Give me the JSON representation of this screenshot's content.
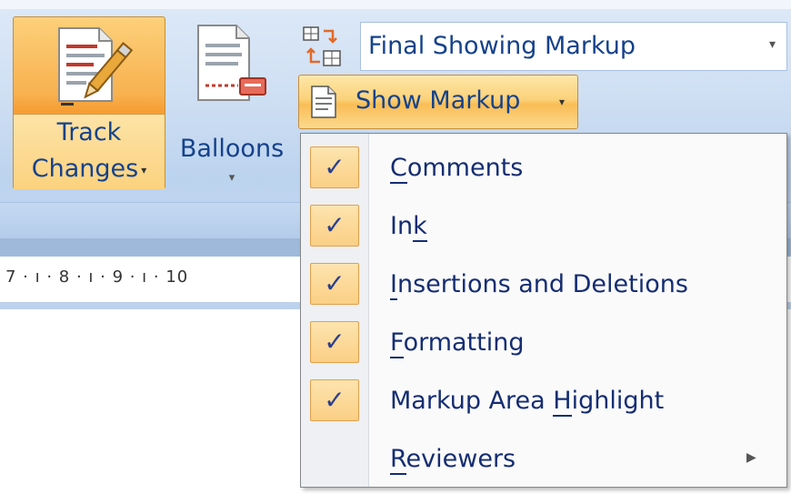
{
  "ribbon": {
    "track_changes": {
      "line1": "Track",
      "line2": "Changes"
    },
    "balloons": {
      "label": "Balloons"
    },
    "display_for_review": {
      "value": "Final Showing Markup"
    },
    "show_markup": {
      "label": "Show Markup"
    }
  },
  "ruler": {
    "text": "7 · ı · 8 · ı · 9 · ı · 10"
  },
  "menu": {
    "items": [
      {
        "label": "Comments",
        "checked": true,
        "accelerator": "C"
      },
      {
        "label": "Ink",
        "checked": true,
        "accelerator": "k"
      },
      {
        "label": "Insertions and Deletions",
        "checked": true,
        "accelerator": "I"
      },
      {
        "label": "Formatting",
        "checked": true,
        "accelerator": "F"
      },
      {
        "label": "Markup Area Highlight",
        "checked": true,
        "accelerator": "H"
      },
      {
        "label": "Reviewers",
        "checked": false,
        "accelerator": "R",
        "has_submenu": true
      }
    ],
    "check_glyph": "✓"
  },
  "icons": {
    "track_changes": "document-pencil-icon",
    "balloons": "document-balloon-icon",
    "display_for_review": "review-pane-icon",
    "show_markup": "document-icon",
    "dropdown": "chevron-down-icon",
    "submenu": "chevron-right-icon"
  },
  "colors": {
    "ribbon_bg": "#cfdff3",
    "highlight_orange": "#f9bd55",
    "text_blue": "#15428b",
    "menu_bg": "#fafafa"
  }
}
